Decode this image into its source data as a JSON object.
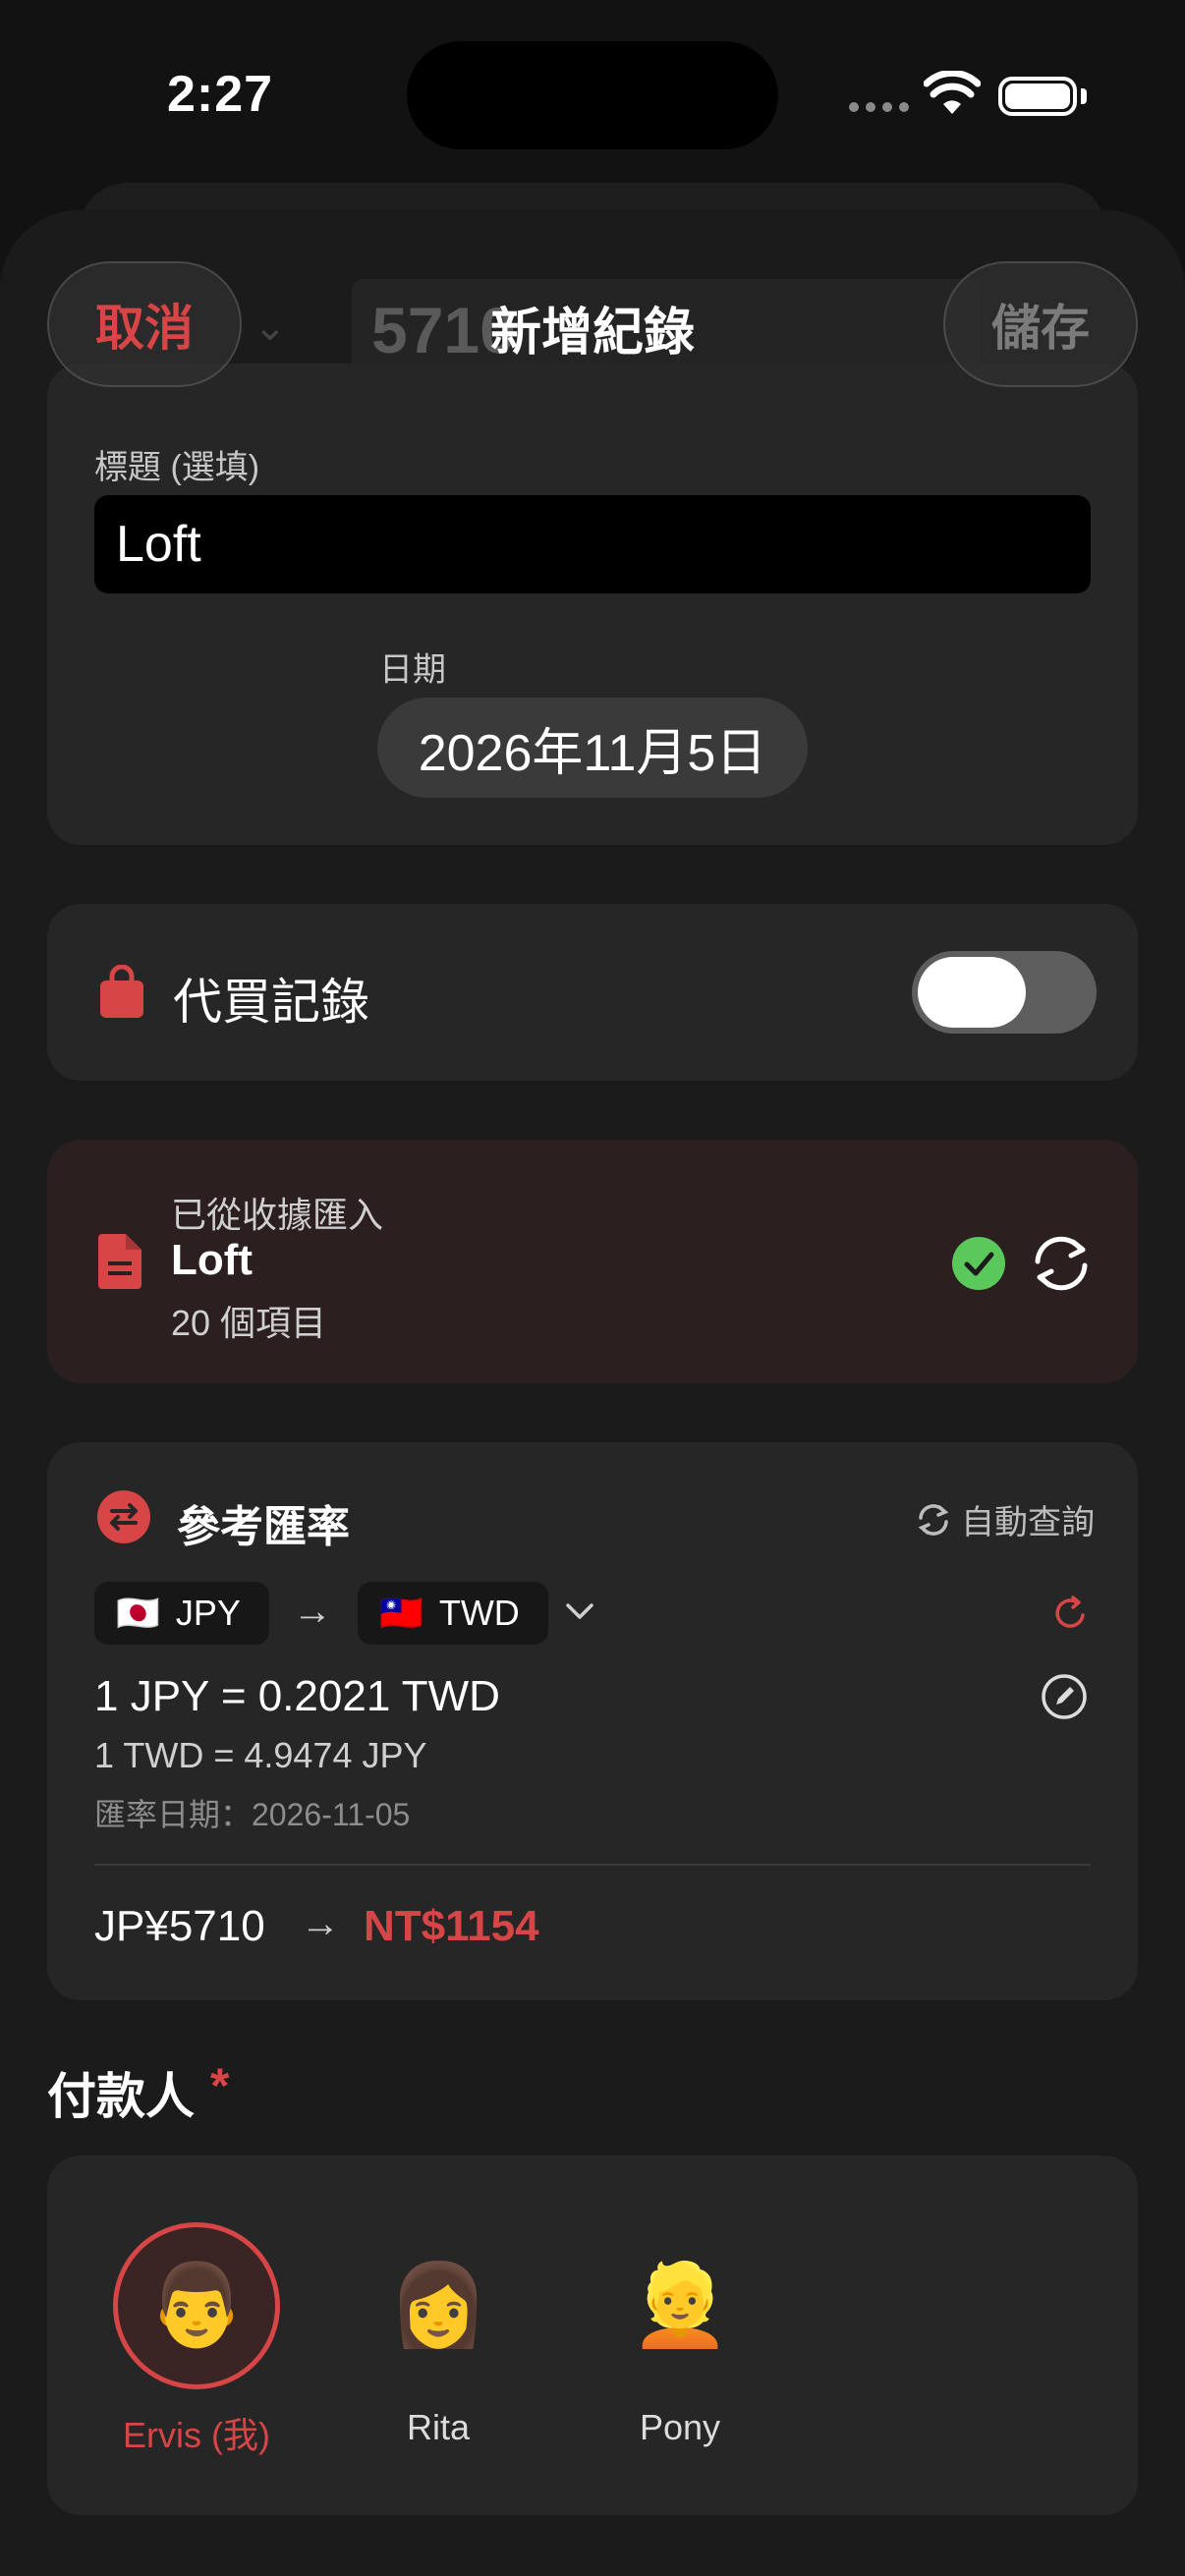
{
  "status_bar": {
    "time": "2:27"
  },
  "nav": {
    "cancel_label": "取消",
    "title": "新增紀錄",
    "save_label": "儲存",
    "ghost_amount": "5710",
    "ghost_chevron": "⌄"
  },
  "form": {
    "title_label": "標題 (選填)",
    "title_value": "Loft",
    "date_label": "日期",
    "date_value": "2026年11月5日"
  },
  "proxy_purchase": {
    "label": "代買記錄",
    "enabled": false,
    "icon": "shopping-bag-icon"
  },
  "receipt_import": {
    "caption": "已從收據匯入",
    "name": "Loft",
    "count": "20 個項目",
    "icon": "document-icon"
  },
  "exchange": {
    "title": "參考匯率",
    "auto_query": "自動查詢",
    "from_flag": "🇯🇵",
    "from_currency": "JPY",
    "arrow": "→",
    "to_flag": "🇹🇼",
    "to_currency": "TWD",
    "rate_main": "1 JPY = 0.2021 TWD",
    "rate_inverse": "1 TWD = 4.9474 JPY",
    "rate_date": "匯率日期：2026-11-05",
    "amount_from": "JP¥5710",
    "amount_to": "NT$1154"
  },
  "payers": {
    "title": "付款人",
    "required_mark": "*",
    "items": [
      {
        "emoji": "👨",
        "name": "Ervis (我)",
        "selected": true
      },
      {
        "emoji": "👩",
        "name": "Rita",
        "selected": false
      },
      {
        "emoji": "👱",
        "name": "Pony",
        "selected": false
      }
    ]
  },
  "colors": {
    "accent": "#d84546",
    "success": "#5ac85a",
    "card": "#262626",
    "background": "#121212"
  }
}
